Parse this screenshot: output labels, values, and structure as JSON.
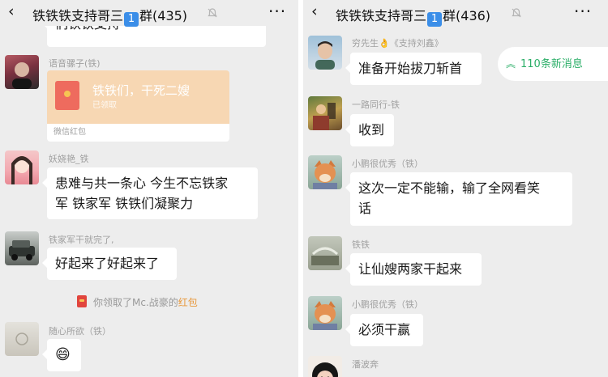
{
  "colors": {
    "background": "#ededed",
    "bubble": "#ffffff",
    "new_messages": "#2aae67",
    "redpacket": "#f7d7b3",
    "link": "#e8983b"
  },
  "left": {
    "header": {
      "back_icon": "‹",
      "title_prefix": "铁铁铁支持哥三",
      "group_number": "1",
      "title_suffix": "群(435)",
      "mute_icon": "bell-mute",
      "more_icon": "···"
    },
    "partial_bubble": "们铁铁支持",
    "messages": [
      {
        "nick": "语音骡子(铁)",
        "type": "redpacket",
        "redpacket_title": "铁铁们，干死二嫂",
        "redpacket_status": "已领取",
        "redpacket_footer": "微信红包"
      },
      {
        "nick": "妖娆艳_铁",
        "type": "text",
        "lines": [
          "患难与共一条心  今生不忘铁家",
          "军   铁家军  铁铁们凝聚力"
        ]
      },
      {
        "nick": "铁家军干就完了,",
        "type": "text",
        "lines": [
          "好起来了好起来了"
        ]
      },
      {
        "nick": "随心所欲（铁）",
        "type": "emoji",
        "lines": [
          "😄"
        ]
      }
    ],
    "system_message": {
      "prefix": "你领取了Mc.战豪的",
      "link": "红包"
    }
  },
  "right": {
    "header": {
      "back_icon": "‹",
      "title_prefix": "铁铁铁支持哥三",
      "group_number": "1",
      "title_suffix": "群(436)",
      "mute_icon": "bell-mute",
      "more_icon": "···"
    },
    "new_messages": {
      "text": "110条新消息",
      "icon": "chevron-up-double"
    },
    "messages": [
      {
        "nick": "穷先生👌《支持刘鑫》",
        "lines": [
          "准备开始拔刀斩首"
        ]
      },
      {
        "nick": "一路同行-铁",
        "lines": [
          "收到"
        ]
      },
      {
        "nick": "小鹏很优秀（铁）",
        "lines": [
          "这次一定不能输，输了全网看笑",
          "话"
        ]
      },
      {
        "nick": "铁铁",
        "lines": [
          "让仙嫂两家干起来"
        ]
      },
      {
        "nick": "小鹏很优秀（铁）",
        "lines": [
          "必须干赢"
        ]
      },
      {
        "nick": "潘波奔",
        "lines": []
      }
    ]
  }
}
